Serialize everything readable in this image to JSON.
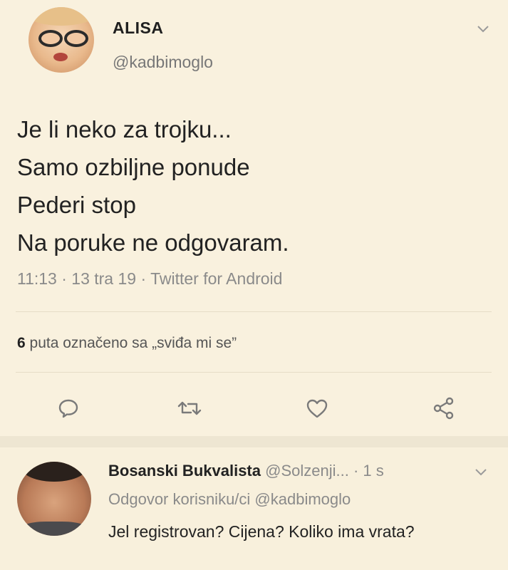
{
  "tweet": {
    "display_name": "ALISA",
    "handle": "@kadbimoglo",
    "lines": [
      "Je li neko za trojku...",
      "Samo ozbiljne ponude",
      "Pederi stop",
      "Na poruke ne odgovaram."
    ],
    "meta": "11:13 · 13 tra 19 · Twitter for Android",
    "likes_count": "6",
    "likes_label": "puta označeno sa „sviđa mi se”"
  },
  "actions": {
    "icons": [
      "reply-icon",
      "retweet-icon",
      "like-icon",
      "share-icon"
    ]
  },
  "reply": {
    "name": "Bosanski Bukvalista",
    "handle": "@Solzenji...",
    "time": "· 1 s",
    "reply_to": "Odgovor korisniku/ci @kadbimoglo",
    "text": "Jel registrovan? Cijena? Koliko ima vrata?"
  },
  "colors": {
    "background": "#f7efdb",
    "text": "#1f1f1f",
    "muted": "#8a8a8a"
  }
}
